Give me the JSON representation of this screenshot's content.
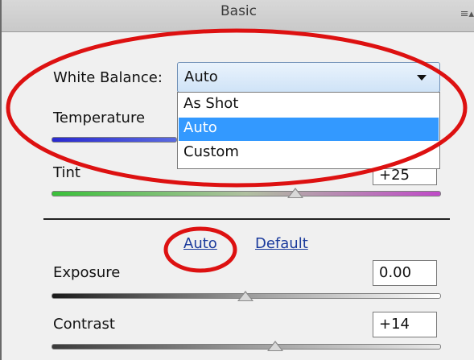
{
  "panel": {
    "title": "Basic",
    "menu_icon": "list-menu-icon"
  },
  "white_balance": {
    "label": "White Balance:",
    "selected": "Auto",
    "options": [
      "As Shot",
      "Auto",
      "Custom"
    ]
  },
  "temperature": {
    "label": "Temperature"
  },
  "tint": {
    "label": "Tint",
    "value": "+25"
  },
  "tone_links": {
    "auto": "Auto",
    "default": "Default"
  },
  "exposure": {
    "label": "Exposure",
    "value": "0.00"
  },
  "contrast": {
    "label": "Contrast",
    "value": "+14"
  },
  "colors": {
    "highlight_selection": "#3399ff",
    "annotation_circle": "#dd1111",
    "link": "#1a3a9c"
  }
}
